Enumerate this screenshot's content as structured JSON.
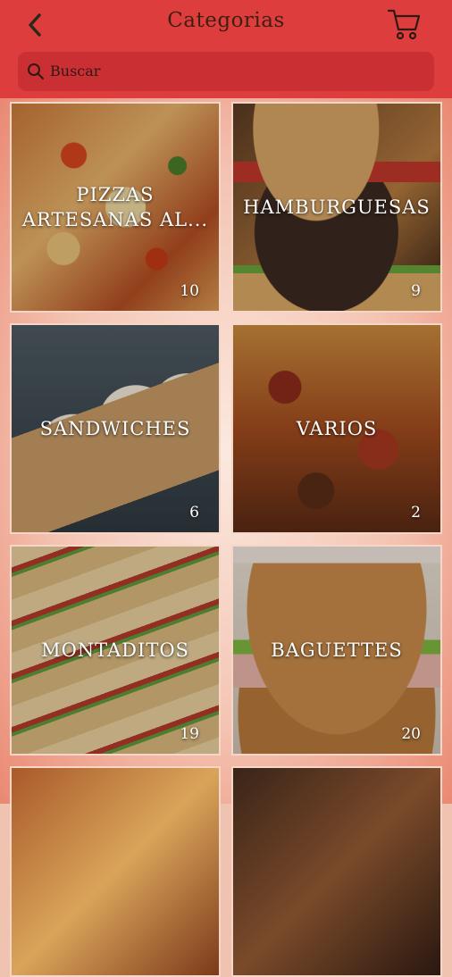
{
  "header": {
    "title": "Categorias"
  },
  "search": {
    "placeholder": "Buscar"
  },
  "categories": [
    {
      "name": "PIZZAS ARTESANAS AL...",
      "count": "10"
    },
    {
      "name": "HAMBURGUESAS",
      "count": "9"
    },
    {
      "name": "SANDWICHES",
      "count": "6"
    },
    {
      "name": "VARIOS",
      "count": "2"
    },
    {
      "name": "MONTADITOS",
      "count": "19"
    },
    {
      "name": "BAGUETTES",
      "count": "20"
    },
    {
      "name": "",
      "count": ""
    },
    {
      "name": "",
      "count": ""
    }
  ],
  "colors": {
    "header": "#de3d3d",
    "search_bg": "#c92f33",
    "title_text": "#3e1f12"
  },
  "icons": {
    "back": "chevron-left-icon",
    "cart": "cart-icon",
    "search": "search-icon"
  }
}
